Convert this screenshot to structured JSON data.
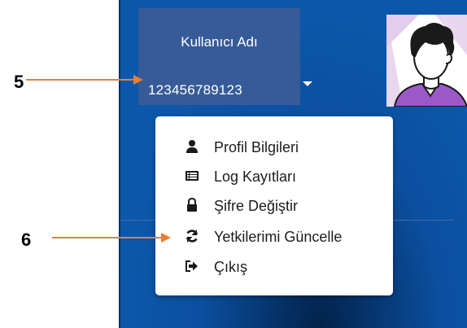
{
  "user": {
    "title": "Kullanıcı Adı",
    "id": "123456789123"
  },
  "menu": {
    "items": [
      {
        "label": "Profil Bilgileri",
        "icon": "user-icon"
      },
      {
        "label": "Log Kayıtları",
        "icon": "list-icon"
      },
      {
        "label": "Şifre Değiştir",
        "icon": "lock-icon"
      },
      {
        "label": "Yetkilerimi Güncelle",
        "icon": "refresh-icon"
      },
      {
        "label": "Çıkış",
        "icon": "sign-out-icon"
      }
    ]
  },
  "annotations": {
    "callout_1": "5",
    "callout_2": "6"
  },
  "colors": {
    "panel_blue": "#0d57aa",
    "user_box": "#365b98",
    "callout_orange": "#ed7d31"
  }
}
